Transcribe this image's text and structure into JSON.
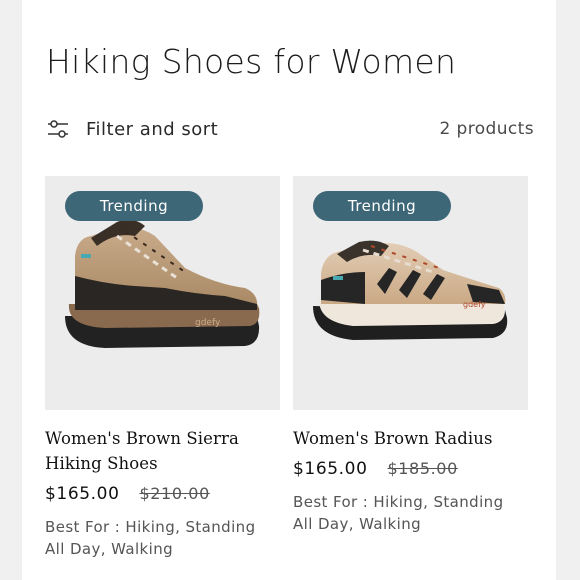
{
  "collection": {
    "title": "Hiking Shoes for Women",
    "filter_label": "Filter and sort",
    "filter_icon": "sliders-icon",
    "product_count": "2 products"
  },
  "products": [
    {
      "badge": "Trending",
      "name": "Women's Brown Sierra Hiking Shoes",
      "price": "$165.00",
      "compare_price": "$210.00",
      "best_for": "Best For : Hiking, Standing All Day, Walking",
      "image_icon": "hiking-boot-image"
    },
    {
      "badge": "Trending",
      "name": "Women's Brown Radius",
      "price": "$165.00",
      "compare_price": "$185.00",
      "best_for": "Best For : Hiking, Standing All Day, Walking",
      "image_icon": "hiking-shoe-image"
    }
  ],
  "colors": {
    "badge_bg": "#3d6677",
    "image_bg": "#ececec"
  }
}
